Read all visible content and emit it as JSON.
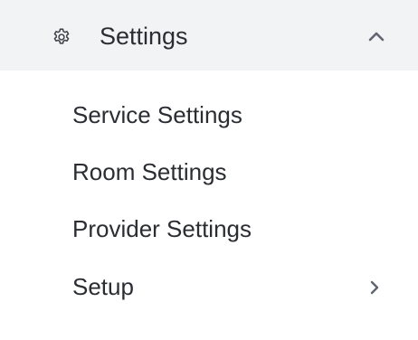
{
  "settings_menu": {
    "header": {
      "icon": "gear-icon",
      "label": "Settings",
      "toggle_icon": "chevron-up-icon",
      "expanded": true
    },
    "items": [
      {
        "label": "Service Settings",
        "has_submenu": false
      },
      {
        "label": "Room Settings",
        "has_submenu": false
      },
      {
        "label": "Provider Settings",
        "has_submenu": false
      },
      {
        "label": "Setup",
        "has_submenu": true,
        "submenu_icon": "chevron-right-icon"
      }
    ],
    "colors": {
      "header_background": "#f2f3f5",
      "text": "#2b2d33",
      "icon": "#3a3d44",
      "chevron": "#5f6670",
      "background": "#ffffff"
    }
  }
}
